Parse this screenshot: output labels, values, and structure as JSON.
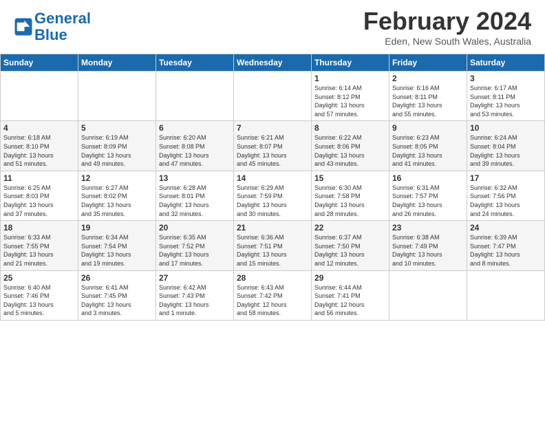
{
  "header": {
    "logo_line1": "General",
    "logo_line2": "Blue",
    "title": "February 2024",
    "location": "Eden, New South Wales, Australia"
  },
  "days_of_week": [
    "Sunday",
    "Monday",
    "Tuesday",
    "Wednesday",
    "Thursday",
    "Friday",
    "Saturday"
  ],
  "weeks": [
    [
      {
        "day": "",
        "info": ""
      },
      {
        "day": "",
        "info": ""
      },
      {
        "day": "",
        "info": ""
      },
      {
        "day": "",
        "info": ""
      },
      {
        "day": "1",
        "info": "Sunrise: 6:14 AM\nSunset: 8:12 PM\nDaylight: 13 hours\nand 57 minutes."
      },
      {
        "day": "2",
        "info": "Sunrise: 6:16 AM\nSunset: 8:11 PM\nDaylight: 13 hours\nand 55 minutes."
      },
      {
        "day": "3",
        "info": "Sunrise: 6:17 AM\nSunset: 8:11 PM\nDaylight: 13 hours\nand 53 minutes."
      }
    ],
    [
      {
        "day": "4",
        "info": "Sunrise: 6:18 AM\nSunset: 8:10 PM\nDaylight: 13 hours\nand 51 minutes."
      },
      {
        "day": "5",
        "info": "Sunrise: 6:19 AM\nSunset: 8:09 PM\nDaylight: 13 hours\nand 49 minutes."
      },
      {
        "day": "6",
        "info": "Sunrise: 6:20 AM\nSunset: 8:08 PM\nDaylight: 13 hours\nand 47 minutes."
      },
      {
        "day": "7",
        "info": "Sunrise: 6:21 AM\nSunset: 8:07 PM\nDaylight: 13 hours\nand 45 minutes."
      },
      {
        "day": "8",
        "info": "Sunrise: 6:22 AM\nSunset: 8:06 PM\nDaylight: 13 hours\nand 43 minutes."
      },
      {
        "day": "9",
        "info": "Sunrise: 6:23 AM\nSunset: 8:05 PM\nDaylight: 13 hours\nand 41 minutes."
      },
      {
        "day": "10",
        "info": "Sunrise: 6:24 AM\nSunset: 8:04 PM\nDaylight: 13 hours\nand 39 minutes."
      }
    ],
    [
      {
        "day": "11",
        "info": "Sunrise: 6:25 AM\nSunset: 8:03 PM\nDaylight: 13 hours\nand 37 minutes."
      },
      {
        "day": "12",
        "info": "Sunrise: 6:27 AM\nSunset: 8:02 PM\nDaylight: 13 hours\nand 35 minutes."
      },
      {
        "day": "13",
        "info": "Sunrise: 6:28 AM\nSunset: 8:01 PM\nDaylight: 13 hours\nand 32 minutes."
      },
      {
        "day": "14",
        "info": "Sunrise: 6:29 AM\nSunset: 7:59 PM\nDaylight: 13 hours\nand 30 minutes."
      },
      {
        "day": "15",
        "info": "Sunrise: 6:30 AM\nSunset: 7:58 PM\nDaylight: 13 hours\nand 28 minutes."
      },
      {
        "day": "16",
        "info": "Sunrise: 6:31 AM\nSunset: 7:57 PM\nDaylight: 13 hours\nand 26 minutes."
      },
      {
        "day": "17",
        "info": "Sunrise: 6:32 AM\nSunset: 7:56 PM\nDaylight: 13 hours\nand 24 minutes."
      }
    ],
    [
      {
        "day": "18",
        "info": "Sunrise: 6:33 AM\nSunset: 7:55 PM\nDaylight: 13 hours\nand 21 minutes."
      },
      {
        "day": "19",
        "info": "Sunrise: 6:34 AM\nSunset: 7:54 PM\nDaylight: 13 hours\nand 19 minutes."
      },
      {
        "day": "20",
        "info": "Sunrise: 6:35 AM\nSunset: 7:52 PM\nDaylight: 13 hours\nand 17 minutes."
      },
      {
        "day": "21",
        "info": "Sunrise: 6:36 AM\nSunset: 7:51 PM\nDaylight: 13 hours\nand 15 minutes."
      },
      {
        "day": "22",
        "info": "Sunrise: 6:37 AM\nSunset: 7:50 PM\nDaylight: 13 hours\nand 12 minutes."
      },
      {
        "day": "23",
        "info": "Sunrise: 6:38 AM\nSunset: 7:49 PM\nDaylight: 13 hours\nand 10 minutes."
      },
      {
        "day": "24",
        "info": "Sunrise: 6:39 AM\nSunset: 7:47 PM\nDaylight: 13 hours\nand 8 minutes."
      }
    ],
    [
      {
        "day": "25",
        "info": "Sunrise: 6:40 AM\nSunset: 7:46 PM\nDaylight: 13 hours\nand 5 minutes."
      },
      {
        "day": "26",
        "info": "Sunrise: 6:41 AM\nSunset: 7:45 PM\nDaylight: 13 hours\nand 3 minutes."
      },
      {
        "day": "27",
        "info": "Sunrise: 6:42 AM\nSunset: 7:43 PM\nDaylight: 13 hours\nand 1 minute."
      },
      {
        "day": "28",
        "info": "Sunrise: 6:43 AM\nSunset: 7:42 PM\nDaylight: 12 hours\nand 58 minutes."
      },
      {
        "day": "29",
        "info": "Sunrise: 6:44 AM\nSunset: 7:41 PM\nDaylight: 12 hours\nand 56 minutes."
      },
      {
        "day": "",
        "info": ""
      },
      {
        "day": "",
        "info": ""
      }
    ]
  ]
}
